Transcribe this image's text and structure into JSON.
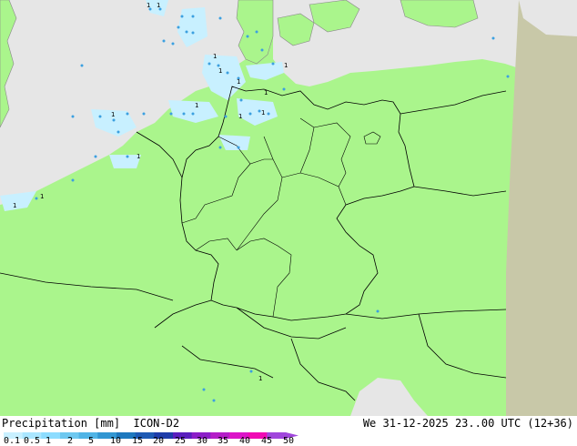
{
  "colors": {
    "land": "#aaf58c",
    "sea": "#e6e6e6",
    "outside_domain": "#c8c8a8",
    "border": "#000000",
    "coast": "#888888",
    "precip_light": "#c8f0ff",
    "precip_dot": "#3ca0e0"
  },
  "scale_colors": [
    "#c8f0ff",
    "#aae6ff",
    "#8cdcff",
    "#6ec8f0",
    "#50b4e6",
    "#3296d2",
    "#1e78be",
    "#1e5ab4",
    "#1e3caa",
    "#5a1ebe",
    "#8c1ec8",
    "#b41ec8",
    "#dc14c8",
    "#f00ab4",
    "#a046dc"
  ],
  "footer": {
    "title_left": "Precipitation [mm]  ICON-D2",
    "title_right": "We 31-12-2025 23..00 UTC (12+36)",
    "scale_ticks": [
      "0.1",
      "0.5",
      "1",
      "2",
      "5",
      "10",
      "15",
      "20",
      "25",
      "30",
      "35",
      "40",
      "45",
      "50"
    ]
  },
  "map_labels": [
    "1",
    "1",
    "1",
    "1",
    "1",
    "1",
    "1",
    "1",
    "1",
    "1",
    "1",
    "1",
    "1",
    "1",
    "1"
  ]
}
